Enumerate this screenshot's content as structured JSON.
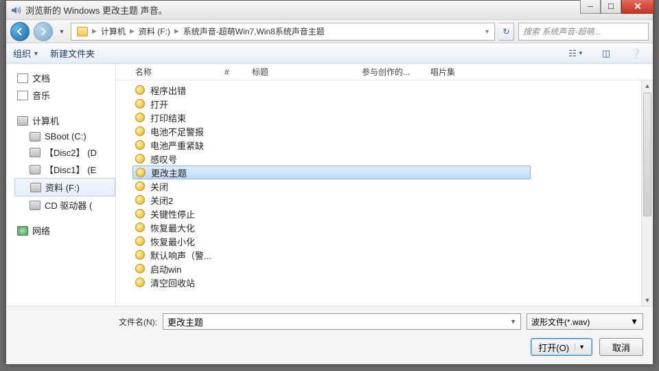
{
  "title": "浏览新的 Windows 更改主题 声音。",
  "nav": {
    "path": [
      "计算机",
      "资料 (F:)",
      "系统声音-超萌Win7,Win8系统声音主题"
    ],
    "search_placeholder": "搜索 系统声音-超萌..."
  },
  "toolbar": {
    "organize": "组织",
    "newfolder": "新建文件夹"
  },
  "sidebar": {
    "libs": [
      "文档",
      "音乐"
    ],
    "computer": "计算机",
    "drives": [
      "SBoot (C:)",
      "【Disc2】 (D",
      "【Disc1】 (E",
      "资料 (F:)",
      "CD 驱动器 ("
    ],
    "network": "网络",
    "selected": "资料 (F:)"
  },
  "columns": {
    "name": "名称",
    "num": "#",
    "title": "标题",
    "artists": "参与创作的...",
    "album": "唱片集"
  },
  "files": [
    "程序出错",
    "打开",
    "打印结束",
    "电池不足警报",
    "电池严重紧缺",
    "感叹号",
    "更改主题",
    "关闭",
    "关闭2",
    "关键性停止",
    "恢复最大化",
    "恢复最小化",
    "默认响声（警...",
    "启动win",
    "清空回收站"
  ],
  "selected_file": "更改主题",
  "footer": {
    "fname_label": "文件名(N):",
    "fname_value": "更改主题",
    "filter": "波形文件(*.wav)",
    "open": "打开(O)",
    "cancel": "取消"
  }
}
